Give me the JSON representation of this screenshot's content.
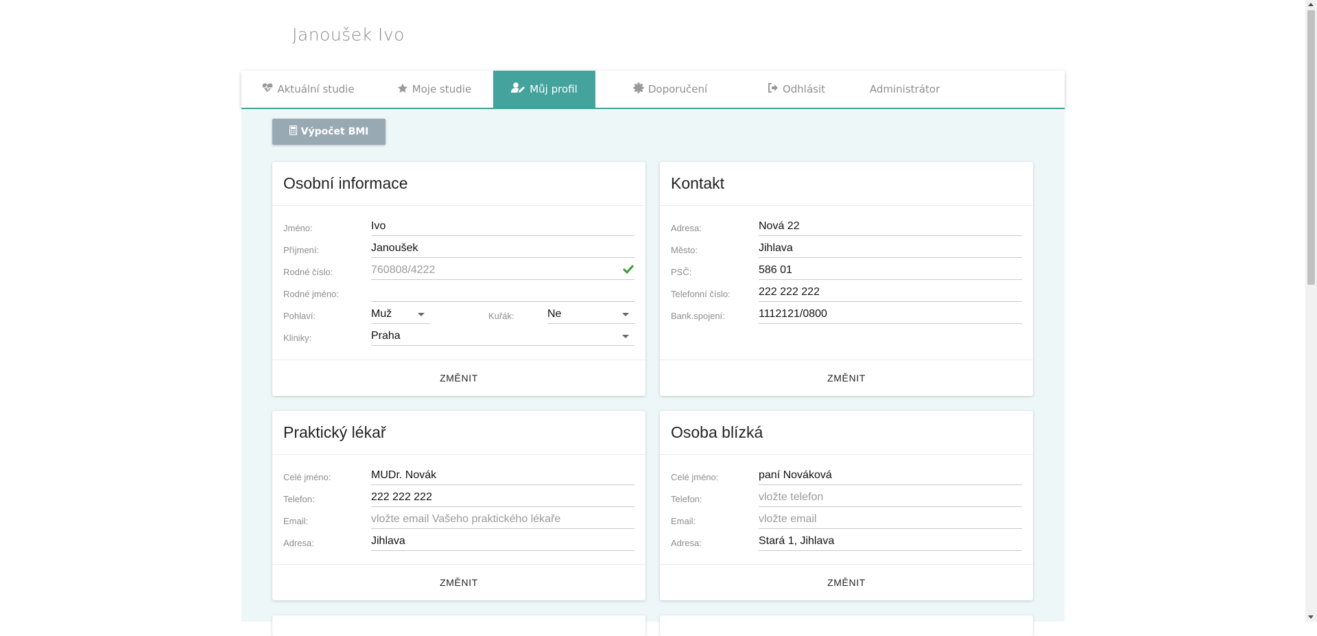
{
  "header": {
    "user_name": "Janoušek Ivo"
  },
  "tabs": [
    {
      "label": "Aktuální studie",
      "icon": "heartbeat-icon"
    },
    {
      "label": "Moje studie",
      "icon": "star-icon"
    },
    {
      "label": "Můj profil",
      "icon": "user-edit-icon",
      "active": true
    },
    {
      "label": "Doporučení",
      "icon": "certificate-icon"
    },
    {
      "label": "Odhlásit",
      "icon": "sign-out-icon"
    },
    {
      "label": "Administrátor",
      "icon": ""
    }
  ],
  "bmi_button": {
    "label": "Výpočet BMI",
    "icon": "calculator-icon"
  },
  "personal": {
    "title": "Osobní informace",
    "first_name": {
      "label": "Jméno:",
      "value": "Ivo"
    },
    "last_name": {
      "label": "Příjmení:",
      "value": "Janoušek"
    },
    "birth_number": {
      "label": "Rodné číslo:",
      "value": "760808/4222",
      "verified_icon": "check-icon"
    },
    "maiden_name": {
      "label": "Rodné jméno:",
      "value": ""
    },
    "gender": {
      "label": "Pohlaví:",
      "value": "Muž"
    },
    "smoker": {
      "label": "Kuřák:",
      "value": "Ne"
    },
    "clinic": {
      "label": "Kliniky:",
      "value": "Praha"
    },
    "change_label": "ZMĚNIT"
  },
  "contact": {
    "title": "Kontakt",
    "address": {
      "label": "Adresa:",
      "value": "Nová 22"
    },
    "city": {
      "label": "Město:",
      "value": "Jihlava"
    },
    "zip": {
      "label": "PSČ:",
      "value": "586 01"
    },
    "phone": {
      "label": "Telefonní číslo:",
      "value": "222 222 222"
    },
    "bank": {
      "label": "Bank.spojení:",
      "value": "1112121/0800"
    },
    "change_label": "ZMĚNIT"
  },
  "doctor": {
    "title": "Praktický lékař",
    "full_name": {
      "label": "Celé jméno:",
      "value": "MUDr. Novák"
    },
    "phone": {
      "label": "Telefon:",
      "value": "222 222 222"
    },
    "email": {
      "label": "Email:",
      "placeholder": "vložte email Vašeho praktického lékaře"
    },
    "address": {
      "label": "Adresa:",
      "value": "Jihlava"
    },
    "change_label": "ZMĚNIT"
  },
  "relative": {
    "title": "Osoba blízká",
    "full_name": {
      "label": "Celé jméno:",
      "value": "paní Nováková"
    },
    "phone": {
      "label": "Telefon:",
      "placeholder": "vložte telefon"
    },
    "email": {
      "label": "Email:",
      "placeholder": "vložte email"
    },
    "address": {
      "label": "Adresa:",
      "value": "Stará 1, Jihlava"
    },
    "change_label": "ZMĚNIT"
  },
  "colors": {
    "accent": "#44a39d",
    "content_bg": "#edf7f7",
    "check": "#3a9a3a"
  }
}
